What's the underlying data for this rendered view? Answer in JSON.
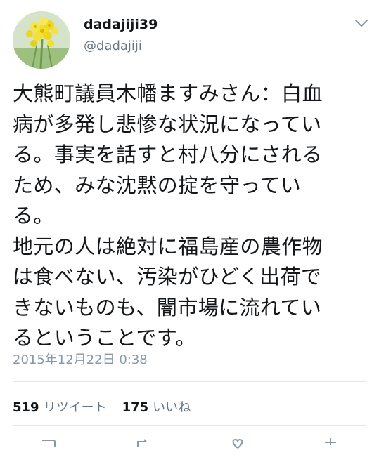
{
  "user": {
    "display_name": "dadajiji39",
    "handle": "@dadajiji"
  },
  "tweet": {
    "lines": [
      "大熊町議員木幡ますみさん：白血",
      "病が多発し悲惨な状況になってい",
      "る。事実を話すと村八分にされる",
      "ため、みな沈黙の掟を守ってい",
      "る。",
      "地元の人は絶対に福島産の農作物",
      "は食べない、汚染がひどく出荷で",
      "きないものも、闇市場に流れてい",
      "るということです。"
    ],
    "timestamp": "2015年12月22日 0:38"
  },
  "stats": {
    "retweet_count": "519",
    "retweet_label": "リツイート",
    "like_count": "175",
    "like_label": "いいね"
  },
  "icons": {
    "caret": "chevron-down-icon",
    "reply": "reply-icon",
    "retweet": "retweet-icon",
    "like": "heart-icon",
    "share": "share-icon"
  },
  "colors": {
    "text": "#14171a",
    "secondary": "#657786",
    "timestamp": "#8899a6",
    "divider": "#e1e8ed"
  }
}
